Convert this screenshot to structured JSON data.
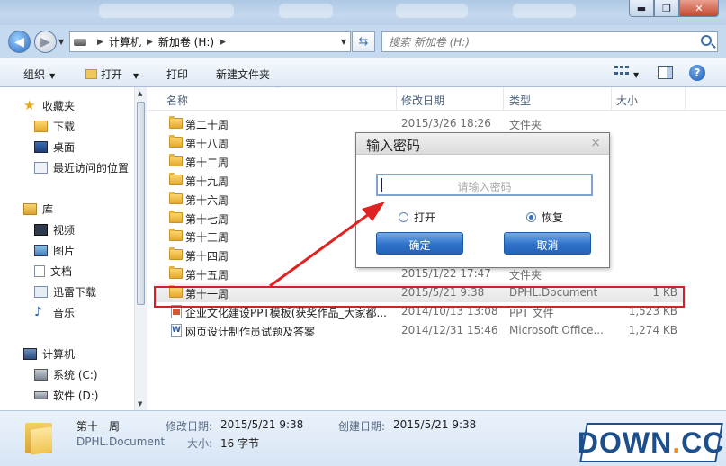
{
  "window": {
    "controls": {
      "minimize": "▬",
      "maximize": "❐",
      "close": "✕"
    }
  },
  "address": {
    "path": [
      "计算机",
      "新加卷 (H:)"
    ],
    "search_placeholder": "搜索 新加卷 (H:)"
  },
  "toolbar": {
    "organize": "组织",
    "open": "打开",
    "print": "打印",
    "new_folder": "新建文件夹"
  },
  "sidebar": {
    "favorites": "收藏夹",
    "downloads": "下载",
    "desktop": "桌面",
    "recent": "最近访问的位置",
    "libraries": "库",
    "videos": "视频",
    "pictures": "图片",
    "documents": "文档",
    "xunlei": "迅雷下载",
    "music": "音乐",
    "computer": "计算机",
    "drive_c": "系统 (C:)",
    "drive_d": "软件 (D:)"
  },
  "columns": {
    "name": "名称",
    "date": "修改日期",
    "type": "类型",
    "size": "大小"
  },
  "files": [
    {
      "name": "第二十周",
      "date": "2015/3/26 18:26",
      "type": "文件夹",
      "size": ""
    },
    {
      "name": "第十八周",
      "date": "",
      "type": "",
      "size": ""
    },
    {
      "name": "第十二周",
      "date": "",
      "type": "",
      "size": ""
    },
    {
      "name": "第十九周",
      "date": "",
      "type": "",
      "size": ""
    },
    {
      "name": "第十六周",
      "date": "",
      "type": "",
      "size": ""
    },
    {
      "name": "第十七周",
      "date": "",
      "type": "",
      "size": ""
    },
    {
      "name": "第十三周",
      "date": "",
      "type": "",
      "size": ""
    },
    {
      "name": "第十四周",
      "date": "",
      "type": "",
      "size": ""
    },
    {
      "name": "第十五周",
      "date": "2015/1/22 17:47",
      "type": "文件夹",
      "size": ""
    },
    {
      "name": "第十一周",
      "date": "2015/5/21 9:38",
      "type": "DPHL.Document",
      "size": "1 KB"
    },
    {
      "name": "企业文化建设PPT模板(获奖作品_大家都...",
      "date": "2014/10/13 13:08",
      "type": "PPT 文件",
      "size": "1,523 KB"
    },
    {
      "name": "网页设计制作员试题及答案",
      "date": "2014/12/31 15:46",
      "type": "Microsoft Office...",
      "size": "1,274 KB"
    }
  ],
  "details": {
    "name": "第十一周",
    "type": "DPHL.Document",
    "modified_label": "修改日期:",
    "modified": "2015/5/21 9:38",
    "created_label": "创建日期:",
    "created": "2015/5/21 9:38",
    "size_label": "大小:",
    "size": "16 字节"
  },
  "dialog": {
    "title": "输入密码",
    "close": "×",
    "password_placeholder": "请输入密码",
    "option_open": "打开",
    "option_restore": "恢复",
    "selected_option": "恢复",
    "ok": "确定",
    "cancel": "取消"
  },
  "watermark": {
    "main": "DOWN",
    "dot": ".",
    "suffix": "CC"
  },
  "colors": {
    "accent": "#2f72c9",
    "highlight": "#d4202a"
  }
}
